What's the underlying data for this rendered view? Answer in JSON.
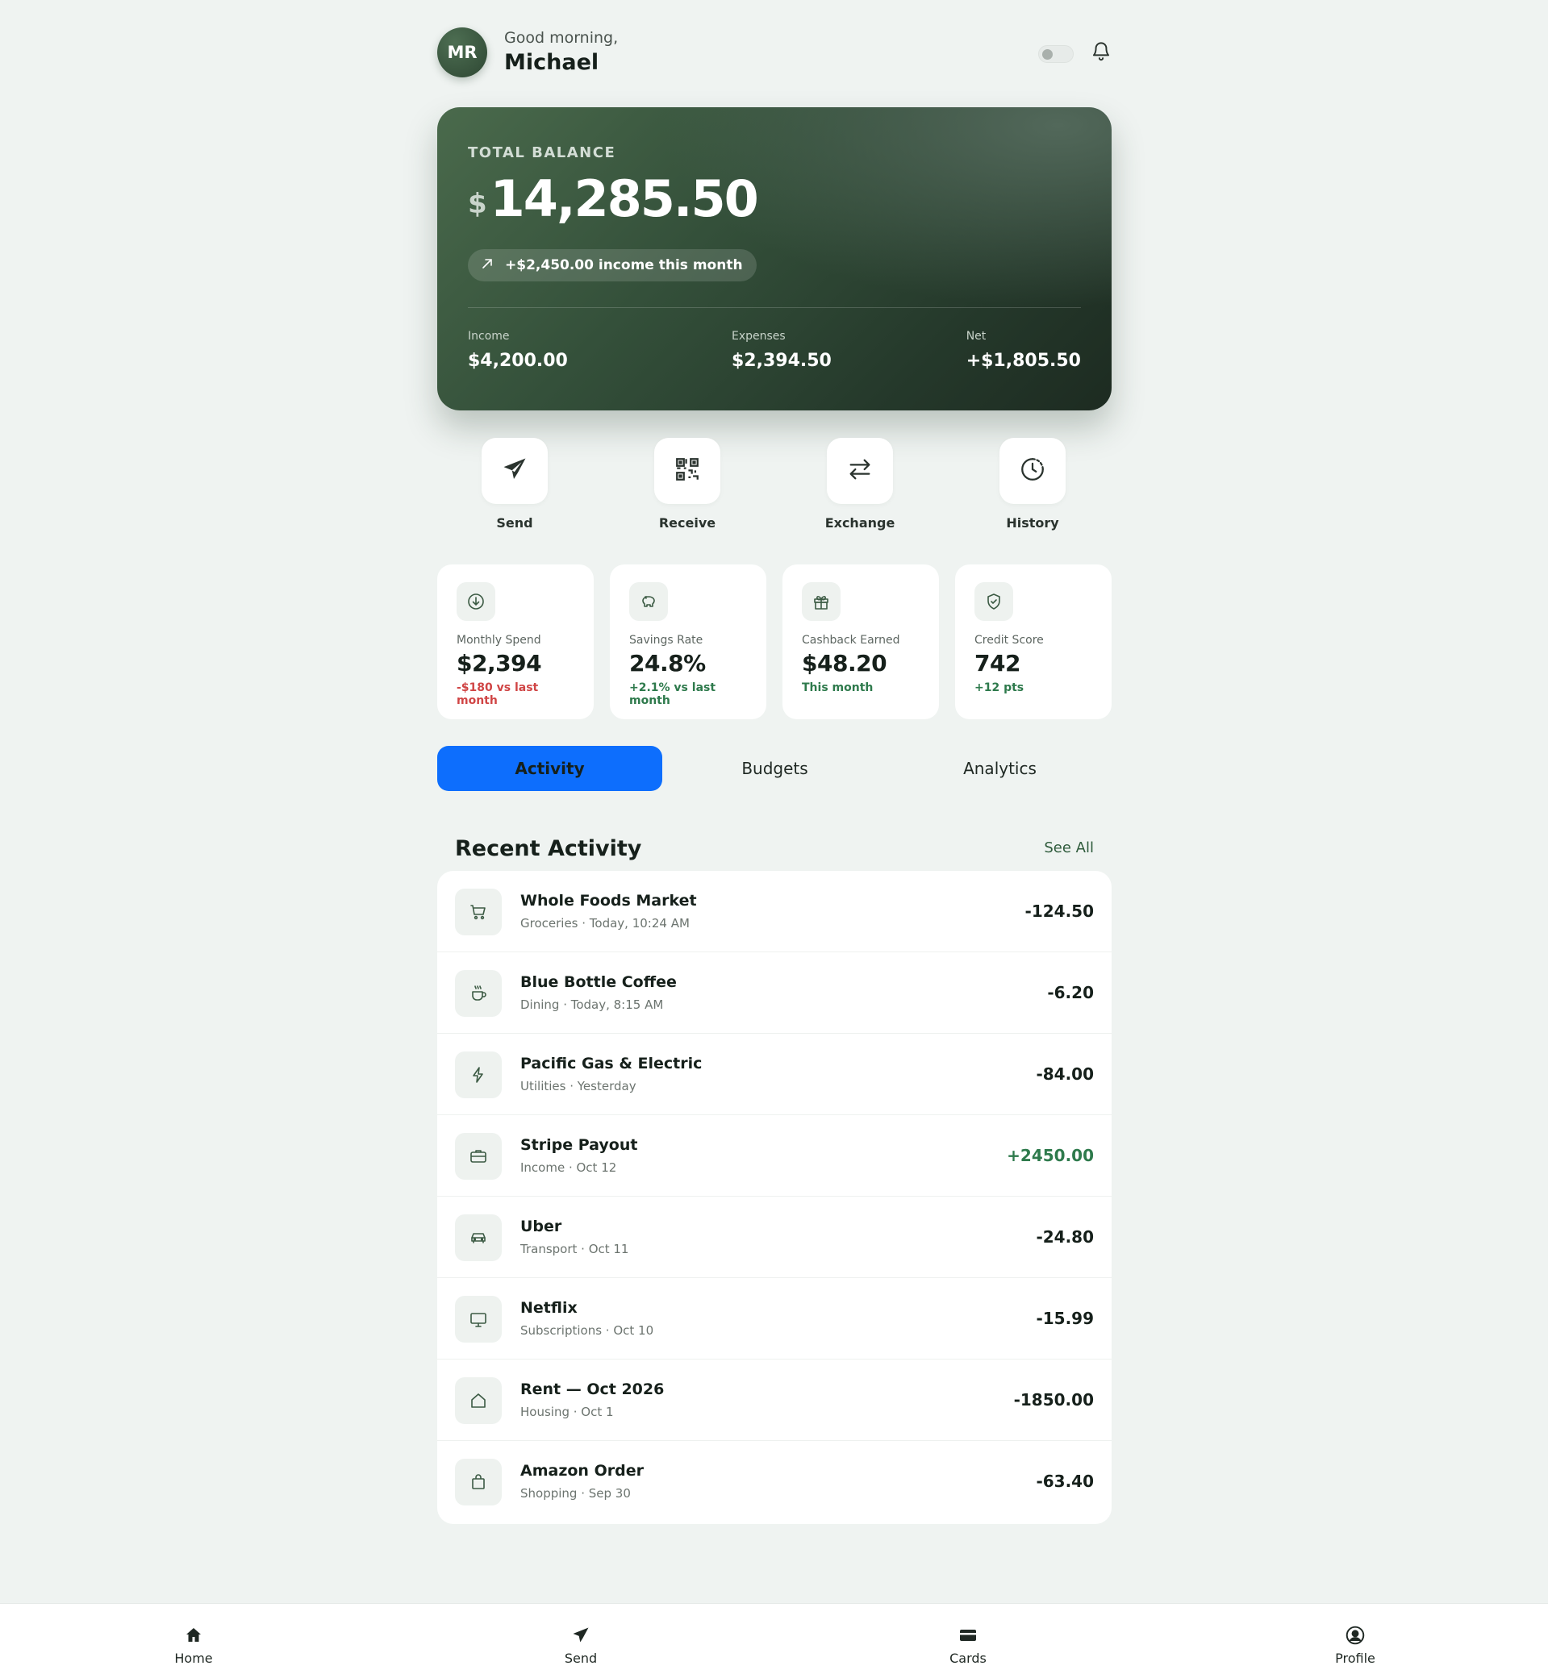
{
  "header": {
    "avatar_initials": "MR",
    "greeting": "Good morning,",
    "username": "Michael"
  },
  "balance": {
    "label": "TOTAL BALANCE",
    "currency": "$",
    "amount": "14,285.50",
    "income_pill": "+$2,450.00 income this month",
    "stats": {
      "income": {
        "label": "Income",
        "value": "$4,200.00"
      },
      "expenses": {
        "label": "Expenses",
        "value": "$2,394.50"
      },
      "net": {
        "label": "Net",
        "value": "+$1,805.50"
      }
    }
  },
  "actions": [
    {
      "label": "Send",
      "icon": "paper-plane-icon"
    },
    {
      "label": "Receive",
      "icon": "qr-code-icon"
    },
    {
      "label": "Exchange",
      "icon": "swap-arrows-icon"
    },
    {
      "label": "History",
      "icon": "clock-icon"
    }
  ],
  "metrics": [
    {
      "label": "Monthly Spend",
      "value": "$2,394",
      "delta": "-$180 vs last month",
      "trend": "negative",
      "icon": "arrow-down-circle-icon"
    },
    {
      "label": "Savings Rate",
      "value": "24.8%",
      "delta": "+2.1% vs last month",
      "trend": "positive",
      "icon": "piggy-bank-icon"
    },
    {
      "label": "Cashback Earned",
      "value": "$48.20",
      "delta": "This month",
      "trend": "positive",
      "icon": "gift-icon"
    },
    {
      "label": "Credit Score",
      "value": "742",
      "delta": "+12 pts",
      "trend": "positive",
      "icon": "shield-check-icon"
    }
  ],
  "tabs": [
    {
      "label": "Activity",
      "active": true
    },
    {
      "label": "Budgets",
      "active": false
    },
    {
      "label": "Analytics",
      "active": false
    }
  ],
  "recent_activity": {
    "title": "Recent Activity",
    "see_all": "See All",
    "transactions": [
      {
        "name": "Whole Foods Market",
        "meta": "Groceries · Today, 10:24 AM",
        "amount": "-124.50",
        "icon": "shopping-cart-icon"
      },
      {
        "name": "Blue Bottle Coffee",
        "meta": "Dining · Today, 8:15 AM",
        "amount": "-6.20",
        "icon": "coffee-cup-icon"
      },
      {
        "name": "Pacific Gas & Electric",
        "meta": "Utilities · Yesterday",
        "amount": "-84.00",
        "icon": "lightning-bolt-icon"
      },
      {
        "name": "Stripe Payout",
        "meta": "Income · Oct 12",
        "amount": "+2450.00",
        "icon": "briefcase-icon"
      },
      {
        "name": "Uber",
        "meta": "Transport · Oct 11",
        "amount": "-24.80",
        "icon": "car-icon"
      },
      {
        "name": "Netflix",
        "meta": "Subscriptions · Oct 10",
        "amount": "-15.99",
        "icon": "monitor-icon"
      },
      {
        "name": "Rent — Oct 2026",
        "meta": "Housing · Oct 1",
        "amount": "-1850.00",
        "icon": "house-icon"
      },
      {
        "name": "Amazon Order",
        "meta": "Shopping · Sep 30",
        "amount": "-63.40",
        "icon": "shopping-bag-icon"
      }
    ]
  },
  "bottom_nav": [
    {
      "label": "Home",
      "icon": "home-icon"
    },
    {
      "label": "Send",
      "icon": "paper-plane-icon"
    },
    {
      "label": "Cards",
      "icon": "credit-card-icon"
    },
    {
      "label": "Profile",
      "icon": "user-circle-icon"
    }
  ],
  "colors": {
    "accent_blue": "#0d6efd",
    "brand_green": "#34503a",
    "positive": "#2e7a4c",
    "negative": "#d04545",
    "background": "#eff3f1"
  }
}
